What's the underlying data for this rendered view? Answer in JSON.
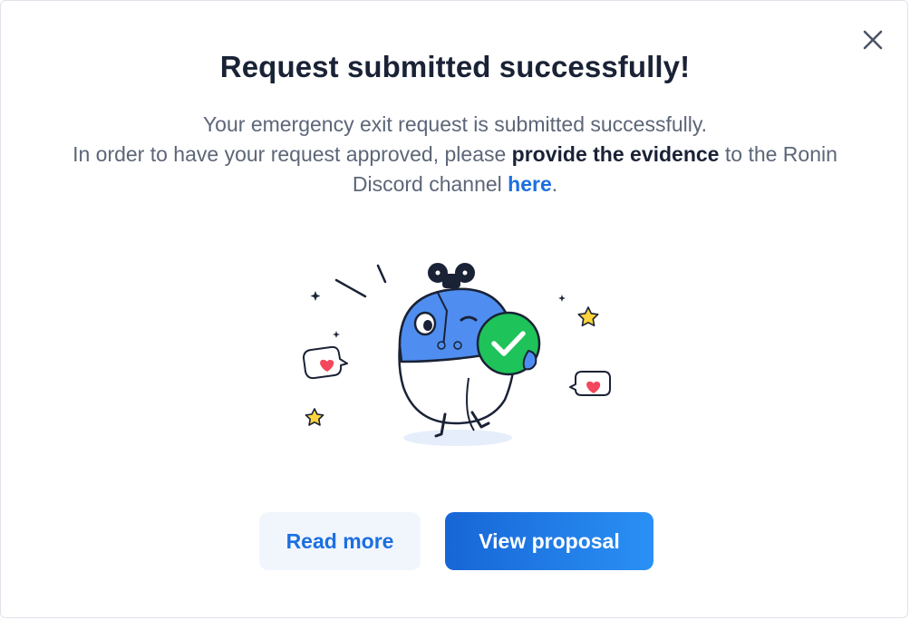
{
  "dialog": {
    "title": "Request submitted successfully!",
    "line1": "Your emergency exit request is submitted successfully.",
    "line2_prefix": "In order to have your request approved, please ",
    "line2_bold": "provide the evidence",
    "line2_suffix": " to the Ronin Discord channel ",
    "link_text": "here",
    "line2_end": ".",
    "close_icon": "close-icon"
  },
  "illustration": {
    "name": "mascot-success-illustration",
    "check_color": "#1ec35a",
    "body_color": "#4f8ef0"
  },
  "buttons": {
    "read_more": "Read more",
    "view_proposal": "View proposal"
  },
  "colors": {
    "title": "#1a2236",
    "text": "#5c6678",
    "accent": "#1c6fe0",
    "primary_gradient_start": "#1766d6",
    "primary_gradient_end": "#2a90f5",
    "secondary_bg": "#f1f6fd"
  }
}
